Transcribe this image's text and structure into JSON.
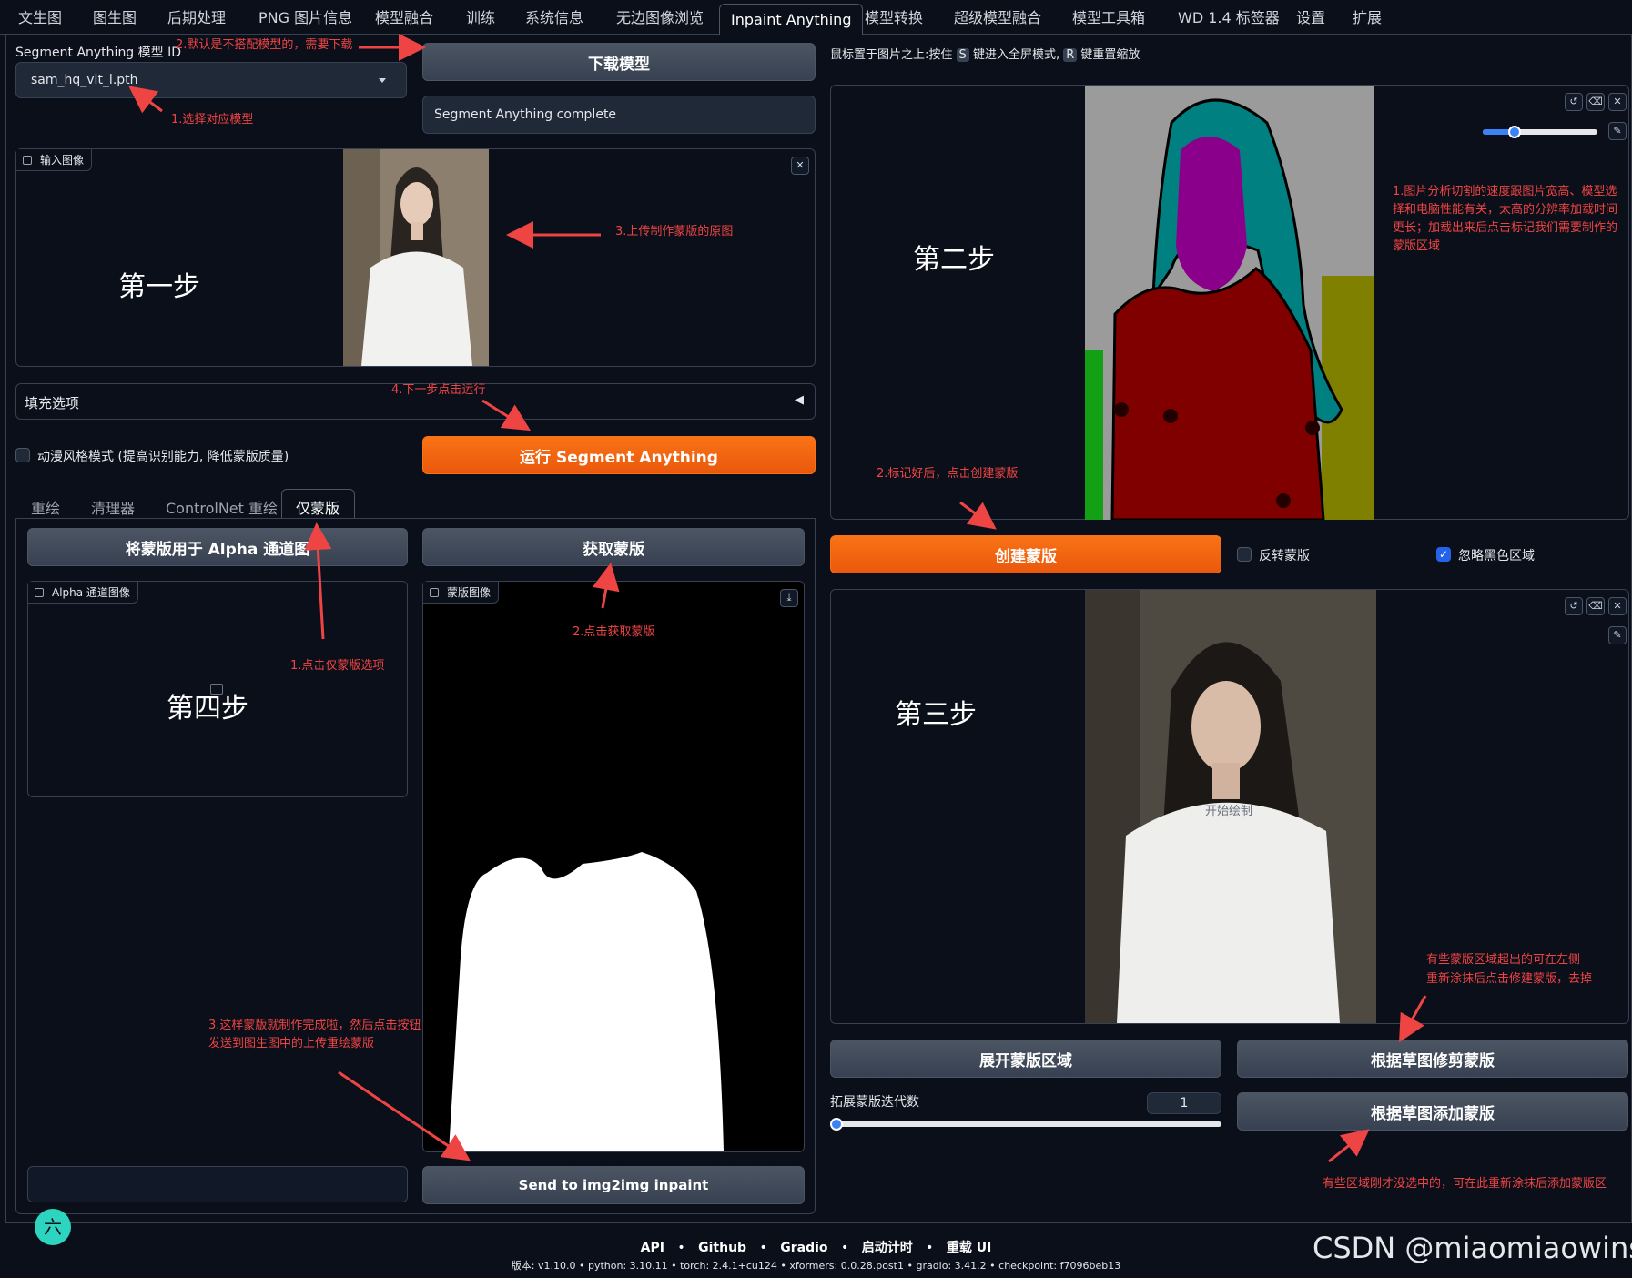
{
  "tabs": [
    "文生图",
    "图生图",
    "后期处理",
    "PNG 图片信息",
    "模型融合",
    "训练",
    "系统信息",
    "无边图像浏览",
    "Inpaint Anything",
    "模型转换",
    "超级模型融合",
    "模型工具箱",
    "WD 1.4 标签器",
    "设置",
    "扩展"
  ],
  "left": {
    "model_label": "Segment Anything 模型 ID",
    "model_value": "sam_hq_vit_l.pth",
    "download_button": "下载模型",
    "status_text": "Segment Anything complete",
    "input_image_label": "输入图像",
    "fill_options": "填充选项",
    "anime_mode_label": "动漫风格模式 (提高识别能力, 降低蒙版质量)",
    "run_button": "运行 Segment Anything",
    "subtabs": [
      "重绘",
      "清理器",
      "ControlNet 重绘",
      "仅蒙版"
    ],
    "alpha_button": "将蒙版用于 Alpha 通道图",
    "get_mask_button": "获取蒙版",
    "alpha_image_label": "Alpha 通道图像",
    "mask_image_label": "蒙版图像",
    "send_button": "Send to img2img inpaint"
  },
  "right": {
    "hint_prefix": "鼠标置于图片之上:按住",
    "hint_key_s": "S",
    "hint_middle": "键进入全屏模式,",
    "hint_key_r": "R",
    "hint_suffix": "键重置缩放",
    "create_mask_button": "创建蒙版",
    "invert_mask_label": "反转蒙版",
    "ignore_black_label": "忽略黑色区域",
    "draw_hint": "开始绘制",
    "expand_button": "展开蒙版区域",
    "trim_button": "根据草图修剪蒙版",
    "add_button": "根据草图添加蒙版",
    "iterations_label": "拓展蒙版迭代数",
    "iterations_value": "1"
  },
  "steps": {
    "step1": "第一步",
    "step2": "第二步",
    "step3": "第三步",
    "step4": "第四步"
  },
  "annotations": {
    "a_download": "2.默认是不搭配模型的，需要下载",
    "a_select": "1.选择对应模型",
    "a_upload": "3.上传制作蒙版的原图",
    "a_run": "4.下一步点击运行",
    "a_mask_only": "1.点击仅蒙版选项",
    "a_get_mask": "2.点击获取蒙版",
    "a_send_1": "3.这样蒙版就制作完成啦，然后点击按钮",
    "a_send_2": "发送到图生图中的上传重绘蒙版",
    "a_analysis_1": "1.图片分析切割的速度跟图片宽高、模型选",
    "a_analysis_2": "择和电脑性能有关，太高的分辨率加载时间",
    "a_analysis_3": "更长；加载出来后点击标记我们需要制作的",
    "a_analysis_4": "蒙版区域",
    "a_create": "2.标记好后，点击创建蒙版",
    "a_trim_1": "有些蒙版区域超出的可在左侧",
    "a_trim_2": "重新涂抹后点击修建蒙版，去掉",
    "a_add": "有些区域刚才没选中的，可在此重新涂抹后添加蒙版区"
  },
  "footer": {
    "links": [
      "API",
      "Github",
      "Gradio",
      "启动计时",
      "重载 UI"
    ],
    "version": "版本: v1.10.0  •  python: 3.10.11  •  torch: 2.4.1+cu124  •  xformers: 0.0.28.post1  •  gradio: 3.41.2  •  checkpoint: f7096beb13"
  },
  "watermark": "CSDN @miaomiaowins",
  "avatar_char": "六",
  "colors": {
    "accent": "#f97316",
    "annotation": "#ef4444",
    "background": "#0b0f19"
  }
}
